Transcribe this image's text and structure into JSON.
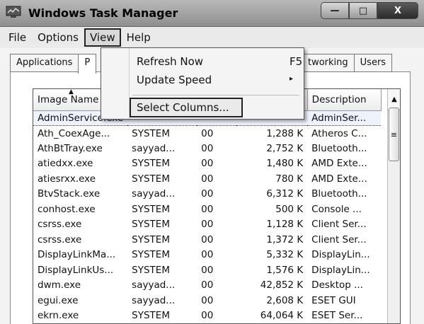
{
  "window": {
    "title": "Windows Task Manager",
    "buttons": [
      "—",
      "□",
      "X"
    ]
  },
  "menubar": {
    "items": [
      "File",
      "Options",
      "View",
      "Help"
    ],
    "active": "View"
  },
  "tabs": {
    "left": [
      "Applications",
      "P"
    ],
    "right": [
      "tworking",
      "Users"
    ]
  },
  "view_menu": {
    "items": [
      {
        "label": "Refresh Now",
        "shortcut": "F5"
      },
      {
        "label": "Update Speed",
        "submenu": "▸"
      },
      {
        "label": "Select Columns..."
      }
    ]
  },
  "table": {
    "columns": [
      "Image Name",
      "",
      "",
      "",
      "Description"
    ],
    "rows": [
      [
        "AdminService.exe",
        "",
        "",
        "",
        "AdminSer..."
      ],
      [
        "Ath_CoexAge...",
        "SYSTEM",
        "00",
        "1,288 K",
        "Atheros C..."
      ],
      [
        "AthBtTray.exe",
        "sayyad...",
        "00",
        "2,752 K",
        "Bluetooth..."
      ],
      [
        "atiedxx.exe",
        "SYSTEM",
        "00",
        "1,480 K",
        "AMD Exte..."
      ],
      [
        "atiesrxx.exe",
        "SYSTEM",
        "00",
        "780 K",
        "AMD Exte..."
      ],
      [
        "BtvStack.exe",
        "sayyad...",
        "00",
        "6,312 K",
        "Bluetooth..."
      ],
      [
        "conhost.exe",
        "SYSTEM",
        "00",
        "500 K",
        "Console ..."
      ],
      [
        "csrss.exe",
        "SYSTEM",
        "00",
        "1,128 K",
        "Client Ser..."
      ],
      [
        "csrss.exe",
        "SYSTEM",
        "00",
        "1,372 K",
        "Client Ser..."
      ],
      [
        "DisplayLinkMa...",
        "SYSTEM",
        "00",
        "5,332 K",
        "DisplayLin..."
      ],
      [
        "DisplayLinkUs...",
        "SYSTEM",
        "00",
        "1,576 K",
        "DisplayLin..."
      ],
      [
        "dwm.exe",
        "sayyad...",
        "00",
        "42,852 K",
        "Desktop ..."
      ],
      [
        "egui.exe",
        "sayyad...",
        "00",
        "2,608 K",
        "ESET GUI"
      ],
      [
        "ekrn.exe",
        "SYSTEM",
        "00",
        "64,064 K",
        "ESET Ser..."
      ]
    ]
  }
}
